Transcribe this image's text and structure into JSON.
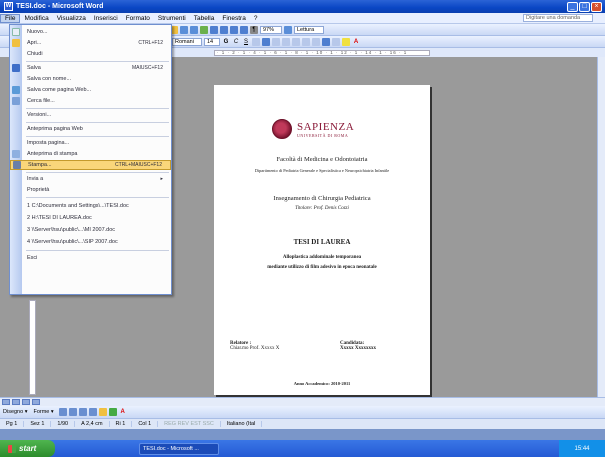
{
  "window": {
    "title": "TESI.doc - Microsoft Word",
    "app_icon": "W",
    "controls": [
      "_",
      "□",
      "×"
    ]
  },
  "menubar": {
    "items": [
      "File",
      "Modifica",
      "Visualizza",
      "Inserisci",
      "Formato",
      "Strumenti",
      "Tabella",
      "Finestra",
      "?"
    ],
    "help_placeholder": "Digitare una domanda"
  },
  "toolbar": {
    "zoom": "97%",
    "style": "Romani",
    "font_size": "14",
    "read_label": "Lettura"
  },
  "ruler_text": "· 1 · 2 · 1 · 4 · 1 · 6 · 1 · 8 · 1 · 10 · 1 · 12 · 1 · 14 · 1 · 16 · 1",
  "file_menu": {
    "items": [
      {
        "label": "Nuovo...",
        "shortcut": ""
      },
      {
        "label": "Apri...",
        "shortcut": "CTRL+F12"
      },
      {
        "label": "Chiudi",
        "shortcut": ""
      },
      {
        "label": "Salva",
        "shortcut": "MAIUSC+F12"
      },
      {
        "label": "Salva con nome...",
        "shortcut": ""
      },
      {
        "label": "Salva come pagina Web...",
        "shortcut": ""
      },
      {
        "label": "Cerca file...",
        "shortcut": ""
      },
      {
        "label": "Versioni...",
        "shortcut": ""
      },
      {
        "label": "Anteprima pagina Web",
        "shortcut": ""
      },
      {
        "label": "Imposta pagina...",
        "shortcut": ""
      },
      {
        "label": "Anteprima di stampa",
        "shortcut": ""
      },
      {
        "label": "Stampa...",
        "shortcut": "CTRL+MAIUSC+F12"
      },
      {
        "label": "Invia a",
        "shortcut": "▸"
      },
      {
        "label": "Proprietà",
        "shortcut": ""
      },
      {
        "label": "1 C:\\Documents and Settings\\...\\TESI.doc",
        "shortcut": ""
      },
      {
        "label": "2 H:\\TESI DI LAUREA.doc",
        "shortcut": ""
      },
      {
        "label": "3 \\\\Server\\hsu\\public\\...\\MI 2007.doc",
        "shortcut": ""
      },
      {
        "label": "4 \\\\Server\\hsu\\public\\...\\SIP 2007.doc",
        "shortcut": ""
      },
      {
        "label": "Esci",
        "shortcut": ""
      }
    ]
  },
  "document": {
    "logo_name": "SAPIENZA",
    "logo_sub": "UNIVERSITÀ DI ROMA",
    "faculty": "Facoltà di Medicina e Odontoiatria",
    "department": "Dipartimento di Pediatria Generale e Specialistica e Neuropsichiatria Infantile",
    "course": "Insegnamento di Chirurgia Pediatrica",
    "holder": "Titolare: Prof. Denis Cozzi",
    "thesis_title": "TESI DI LAUREA",
    "subtitle_1": "Alloplastica addominale temporanea",
    "subtitle_2": "mediante utilizzo di film adesivo in epoca neonatale",
    "relatore_label": "Relatore :",
    "relatore_name": "Chiar.mo Prof. Xxxxx X",
    "candidata_label": "Candidata:",
    "candidata_name": "Xxxxx Xxxxxxxx",
    "academic_year": "Anno Accademico: 2010-2011"
  },
  "drawbar": {
    "draw_label": "Disegno ▾",
    "shapes_label": "Forme ▾"
  },
  "statusbar": {
    "page": "Pg 1",
    "section": "Sez 1",
    "pages": "1/90",
    "position": "A 2,4 cm",
    "line": "Ri 1",
    "col": "Col 1",
    "rec": "REG REV EST SSC",
    "lang": "Italiano (Ital"
  },
  "taskbar": {
    "start_label": "start",
    "task_label": "TESI.doc - Microsoft ...",
    "clock": "15:44"
  }
}
